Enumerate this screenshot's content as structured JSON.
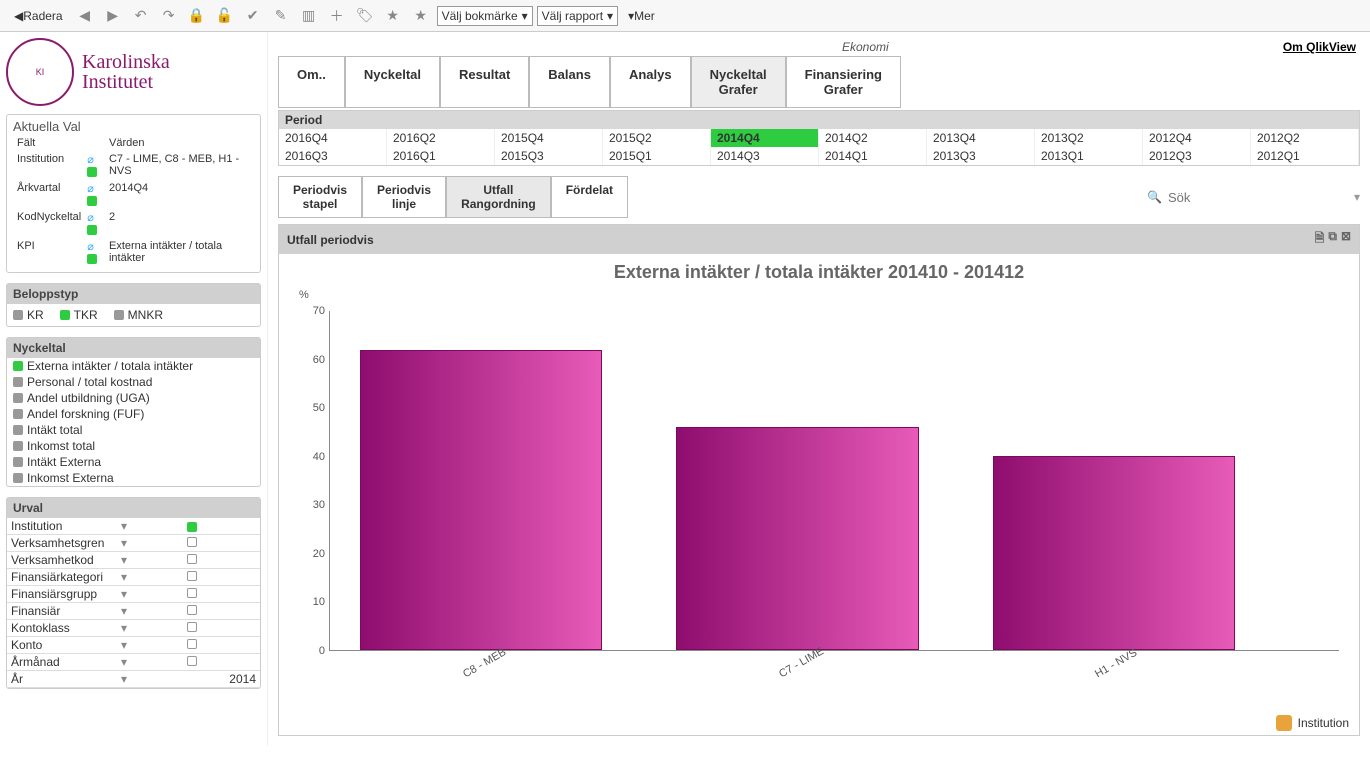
{
  "toolbar": {
    "radera": "Radera",
    "bookmark_select": "Välj bokmärke",
    "report_select": "Välj rapport",
    "mer": "Mer"
  },
  "header": {
    "logo_name1": "Karolinska",
    "logo_name2": "Institutet",
    "ekonomi": "Ekonomi",
    "om_qlikview": "Om QlikView"
  },
  "tabs": [
    "Om..",
    "Nyckeltal",
    "Resultat",
    "Balans",
    "Analys",
    "Nyckeltal Grafer",
    "Finansiering Grafer"
  ],
  "active_tab": 5,
  "period": {
    "label": "Period",
    "cells": [
      [
        "2016Q4",
        "2016Q2",
        "2015Q4",
        "2015Q2",
        "2014Q4",
        "2014Q2",
        "2013Q4",
        "2013Q2",
        "2012Q4",
        "2012Q2"
      ],
      [
        "2016Q3",
        "2016Q1",
        "2015Q3",
        "2015Q1",
        "2014Q3",
        "2014Q1",
        "2013Q3",
        "2013Q1",
        "2012Q3",
        "2012Q1"
      ]
    ],
    "selected": "2014Q4"
  },
  "subtabs": [
    "Periodvis stapel",
    "Periodvis linje",
    "Utfall Rangordning",
    "Fördelat"
  ],
  "active_subtab": 2,
  "search_placeholder": "Sök",
  "aktuella": {
    "title": "Aktuella Val",
    "h_falt": "Fält",
    "h_varden": "Värden",
    "rows": [
      {
        "f": "Institution",
        "v": "C7 - LIME, C8 - MEB, H1 - NVS"
      },
      {
        "f": "Årkvartal",
        "v": "2014Q4"
      },
      {
        "f": "KodNyckeltal",
        "v": "2"
      },
      {
        "f": "KPI",
        "v": "Externa intäkter / totala intäkter"
      }
    ]
  },
  "beloppstyp": {
    "title": "Beloppstyp",
    "options": [
      {
        "label": "KR",
        "sel": false
      },
      {
        "label": "TKR",
        "sel": true
      },
      {
        "label": "MNKR",
        "sel": false
      }
    ]
  },
  "nyckeltal": {
    "title": "Nyckeltal",
    "items": [
      {
        "label": "Externa intäkter / totala intäkter",
        "sel": true
      },
      {
        "label": "Personal / total kostnad",
        "sel": false
      },
      {
        "label": "Andel utbildning (UGA)",
        "sel": false
      },
      {
        "label": "Andel forskning (FUF)",
        "sel": false
      },
      {
        "label": "Intäkt total",
        "sel": false
      },
      {
        "label": "Inkomst total",
        "sel": false
      },
      {
        "label": "Intäkt Externa",
        "sel": false
      },
      {
        "label": "Inkomst Externa",
        "sel": false
      }
    ]
  },
  "urval": {
    "title": "Urval",
    "rows": [
      {
        "label": "Institution",
        "sel": true
      },
      {
        "label": "Verksamhetsgren"
      },
      {
        "label": "Verksamhetkod"
      },
      {
        "label": "Finansiärkategori"
      },
      {
        "label": "Finansiärsgrupp"
      },
      {
        "label": "Finansiär"
      },
      {
        "label": "Kontoklass"
      },
      {
        "label": "Konto"
      },
      {
        "label": "Årmånad"
      },
      {
        "label": "År",
        "val": "2014"
      }
    ]
  },
  "chart": {
    "panel_title": "Utfall periodvis",
    "title": "Externa intäkter / totala intäkter 201410 - 201412",
    "footer": "Institution"
  },
  "chart_data": {
    "type": "bar",
    "categories": [
      "C8 - MEB",
      "C7 - LIME",
      "H1 - NVS"
    ],
    "values": [
      62,
      46,
      40
    ],
    "title": "Externa intäkter / totala intäkter 201410 - 201412",
    "xlabel": "Institution",
    "ylabel": "%",
    "ylim": [
      0,
      70
    ],
    "yticks": [
      0,
      10,
      20,
      30,
      40,
      50,
      60,
      70
    ]
  }
}
